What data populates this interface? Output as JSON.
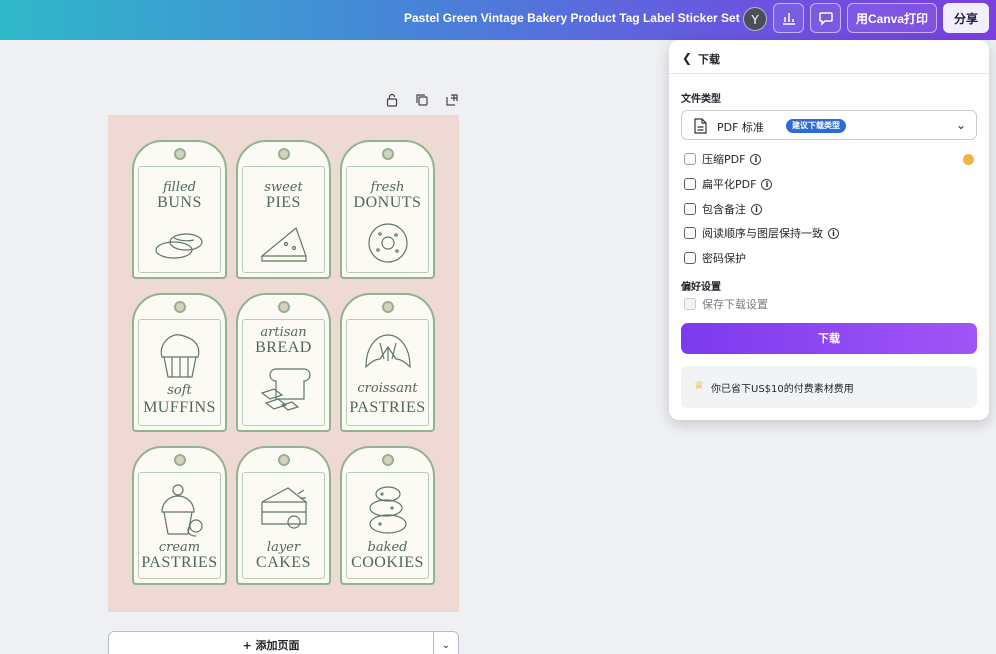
{
  "topbar": {
    "doc_title": "Pastel Green Vintage Bakery Product Tag Label Sticker Set ...",
    "avatar_letter": "Y",
    "print_label": "用Canva打印",
    "share_label": "分享"
  },
  "tags": [
    {
      "script": "filled",
      "word": "BUNS"
    },
    {
      "script": "sweet",
      "word": "PIES"
    },
    {
      "script": "fresh",
      "word": "DONUTS"
    },
    {
      "script": "soft",
      "word": "MUFFINS"
    },
    {
      "script": "artisan",
      "word": "BREAD"
    },
    {
      "script": "croissant",
      "word": "PASTRIES"
    },
    {
      "script": "cream",
      "word": "PASTRIES"
    },
    {
      "script": "layer",
      "word": "CAKES"
    },
    {
      "script": "baked",
      "word": "COOKIES"
    }
  ],
  "canvas": {
    "add_page_label": "+ 添加页面"
  },
  "download_panel": {
    "title": "下载",
    "file_type_label": "文件类型",
    "file_type_value": "PDF 标准",
    "recommended_badge": "建议下载类型",
    "options": [
      {
        "label": "压缩PDF",
        "checked": false,
        "info": true
      },
      {
        "label": "扁平化PDF",
        "checked": false,
        "info": true
      },
      {
        "label": "包含备注",
        "checked": false,
        "info": true
      },
      {
        "label": "阅读顺序与图层保持一致",
        "checked": false,
        "info": true
      },
      {
        "label": "密码保护",
        "checked": false,
        "info": false
      }
    ],
    "preferences_label": "偏好设置",
    "save_settings_label": "保存下载设置",
    "download_button": "下载",
    "savings_text": "你已省下US$10的付费素材费用"
  }
}
